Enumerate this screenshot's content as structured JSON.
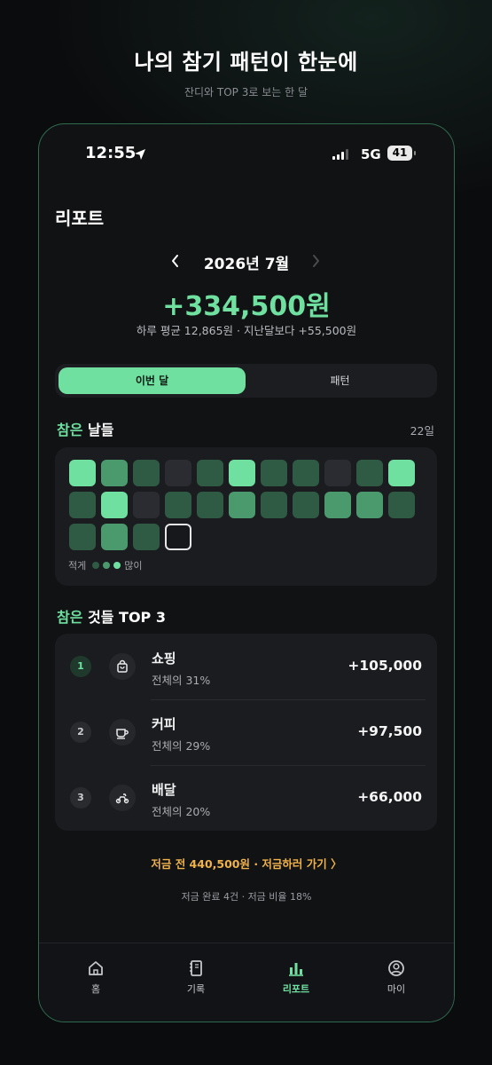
{
  "promo": {
    "title": "나의 참기 패턴이 한눈에",
    "subtitle": "잔디와 TOP 3로 보는 한 달"
  },
  "status_bar": {
    "time": "12:55",
    "network": "5G",
    "battery": "41",
    "icons": [
      "location-arrow-icon",
      "signal-icon",
      "battery-icon"
    ]
  },
  "page": {
    "title": "리포트"
  },
  "month": {
    "label": "2026년 7월",
    "prev_icon": "chevron-left-icon",
    "next_icon": "chevron-right-icon"
  },
  "total": "+334,500원",
  "summary": "하루 평균 12,865원 · 지난달보다 +55,500원",
  "segment": {
    "active": "이번 달",
    "inactive": "패턴"
  },
  "grass": {
    "heading_accent": "참은",
    "heading_rest": " 날들",
    "days_count": "22일",
    "levels": [
      3,
      2,
      1,
      0,
      1,
      3,
      1,
      1,
      0,
      1,
      3,
      1,
      3,
      0,
      1,
      1,
      2,
      1,
      1,
      2,
      2,
      1,
      1,
      2,
      1,
      4
    ],
    "level_colors": [
      "#2a2c31",
      "#2f5a43",
      "#4a9a6d",
      "#6fe0a0",
      "#17181b"
    ],
    "today_index": 25,
    "legend_low": "적게",
    "legend_high": "많이"
  },
  "top3": {
    "heading_accent": "참은",
    "heading_rest": " 것들 TOP 3",
    "items": [
      {
        "rank": "1",
        "icon": "shopping-bag-icon",
        "name": "쇼핑",
        "share": "전체의 31%",
        "amount": "+105,000"
      },
      {
        "rank": "2",
        "icon": "coffee-cup-icon",
        "name": "커피",
        "share": "전체의 29%",
        "amount": "+97,500"
      },
      {
        "rank": "3",
        "icon": "scooter-icon",
        "name": "배달",
        "share": "전체의 20%",
        "amount": "+66,000"
      }
    ]
  },
  "savings": {
    "link": "저금 전 440,500원 · 저금하러 가기 〉",
    "stats": "저금 완료 4건 · 저금 비율 18%"
  },
  "tabs": [
    {
      "label": "홈",
      "icon": "home-icon",
      "active": false
    },
    {
      "label": "기록",
      "icon": "notebook-icon",
      "active": false
    },
    {
      "label": "리포트",
      "icon": "bar-chart-icon",
      "active": true
    },
    {
      "label": "마이",
      "icon": "user-icon",
      "active": false
    }
  ],
  "colors": {
    "accent": "#6fe0a0",
    "warning": "#f0b24a",
    "background": "#111214",
    "card": "#1b1c1f"
  }
}
